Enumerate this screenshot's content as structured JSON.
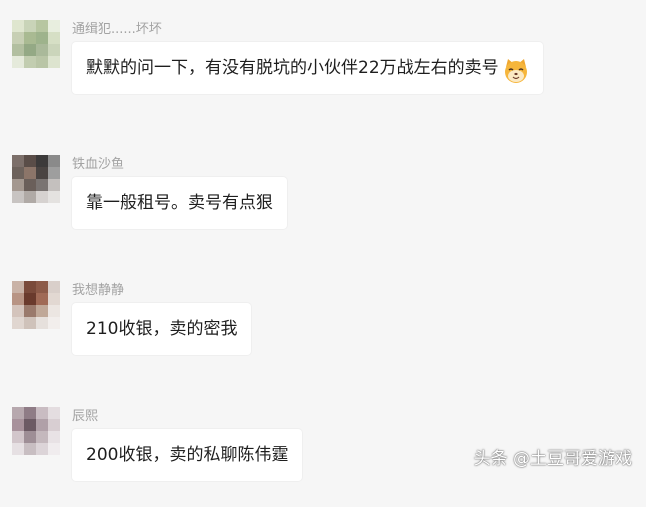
{
  "messages": [
    {
      "sender": "通缉犯......坏坏",
      "text": "默默的问一下，有没有脱坑的小伙伴22万战左右的卖号",
      "emoji": "cat-face-emoji",
      "avatar_palette": [
        "#dfe6cf",
        "#c9d4b8",
        "#b7c6a1",
        "#e8eedf",
        "#c7cfb4",
        "#a9ba92",
        "#9eb38c",
        "#d6dfc5",
        "#b2bfa0",
        "#94a985",
        "#aab99a",
        "#cbd5bb",
        "#e5eadb",
        "#c2cdb0",
        "#b9c5a6",
        "#dde4cf"
      ]
    },
    {
      "sender": "铁血沙鱼",
      "text": "靠一般租号。卖号有点狠",
      "emoji": null,
      "avatar_palette": [
        "#7c6f6a",
        "#5a4d48",
        "#3c3a3a",
        "#8a8a8a",
        "#6d625c",
        "#8c7569",
        "#4a4442",
        "#9e9e9e",
        "#a49890",
        "#6a5f5a",
        "#7a7472",
        "#c4c0be",
        "#c8c4c2",
        "#b0aaa6",
        "#d6d2d0",
        "#e4e2e0"
      ]
    },
    {
      "sender": "我想静静",
      "text": "210收银，卖的密我",
      "emoji": null,
      "avatar_palette": [
        "#c9b2a6",
        "#7a4a3a",
        "#8c5a48",
        "#d9cfca",
        "#b89484",
        "#6a3a2c",
        "#a06a56",
        "#e2d8d2",
        "#d4c4bc",
        "#9a7a6c",
        "#c0a898",
        "#ece6e2",
        "#e0d6d0",
        "#cfc2ba",
        "#e6e0dc",
        "#f2eeec"
      ]
    },
    {
      "sender": "辰熙",
      "text": "200收银，卖的私聊陈伟霆",
      "emoji": null,
      "avatar_palette": [
        "#b7a8ae",
        "#8f7c86",
        "#c9bcc2",
        "#e4dde0",
        "#a8929c",
        "#6c5a64",
        "#b0a0a8",
        "#d8ced2",
        "#d2c6cb",
        "#9e8e96",
        "#c4b8bd",
        "#e8e2e5",
        "#e6e0e3",
        "#c8bec2",
        "#dcd4d8",
        "#f0ecee"
      ]
    }
  ],
  "watermark": "头条 @土豆哥爱游戏"
}
